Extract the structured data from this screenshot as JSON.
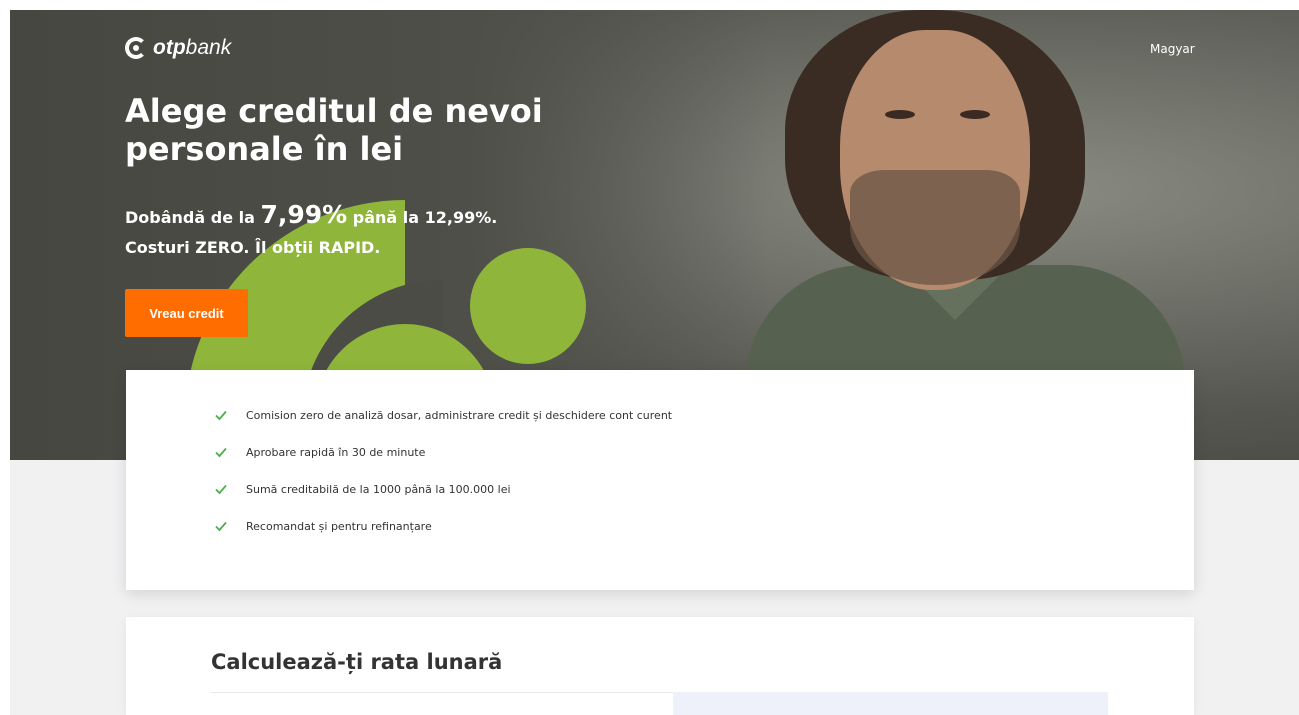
{
  "header": {
    "logo_text_bold": "otp",
    "logo_text_regular": "bank",
    "language_link": "Magyar"
  },
  "hero": {
    "headline": "Alege creditul de nevoi personale în lei",
    "rate_prefix": "Dobândă de la ",
    "rate_value": "7,99%",
    "rate_suffix": " până la 12,99%.",
    "tagline": "Costuri ZERO. Îl obții RAPID.",
    "cta_label": "Vreau credit",
    "cta_color": "#ff6c00",
    "accent_color": "#8fb63a"
  },
  "benefits": [
    "Comision zero de analiză dosar, administrare credit și deschidere cont curent",
    "Aprobare rapidă în 30 de minute",
    "Sumă creditabilă de la 1000 până la 100.000 lei",
    "Recomandat și pentru refinanțare"
  ],
  "calculator": {
    "title": "Calculează-ți rata lunară"
  },
  "icons": {
    "benefit": "check-icon",
    "logo": "otp-logo-icon"
  }
}
